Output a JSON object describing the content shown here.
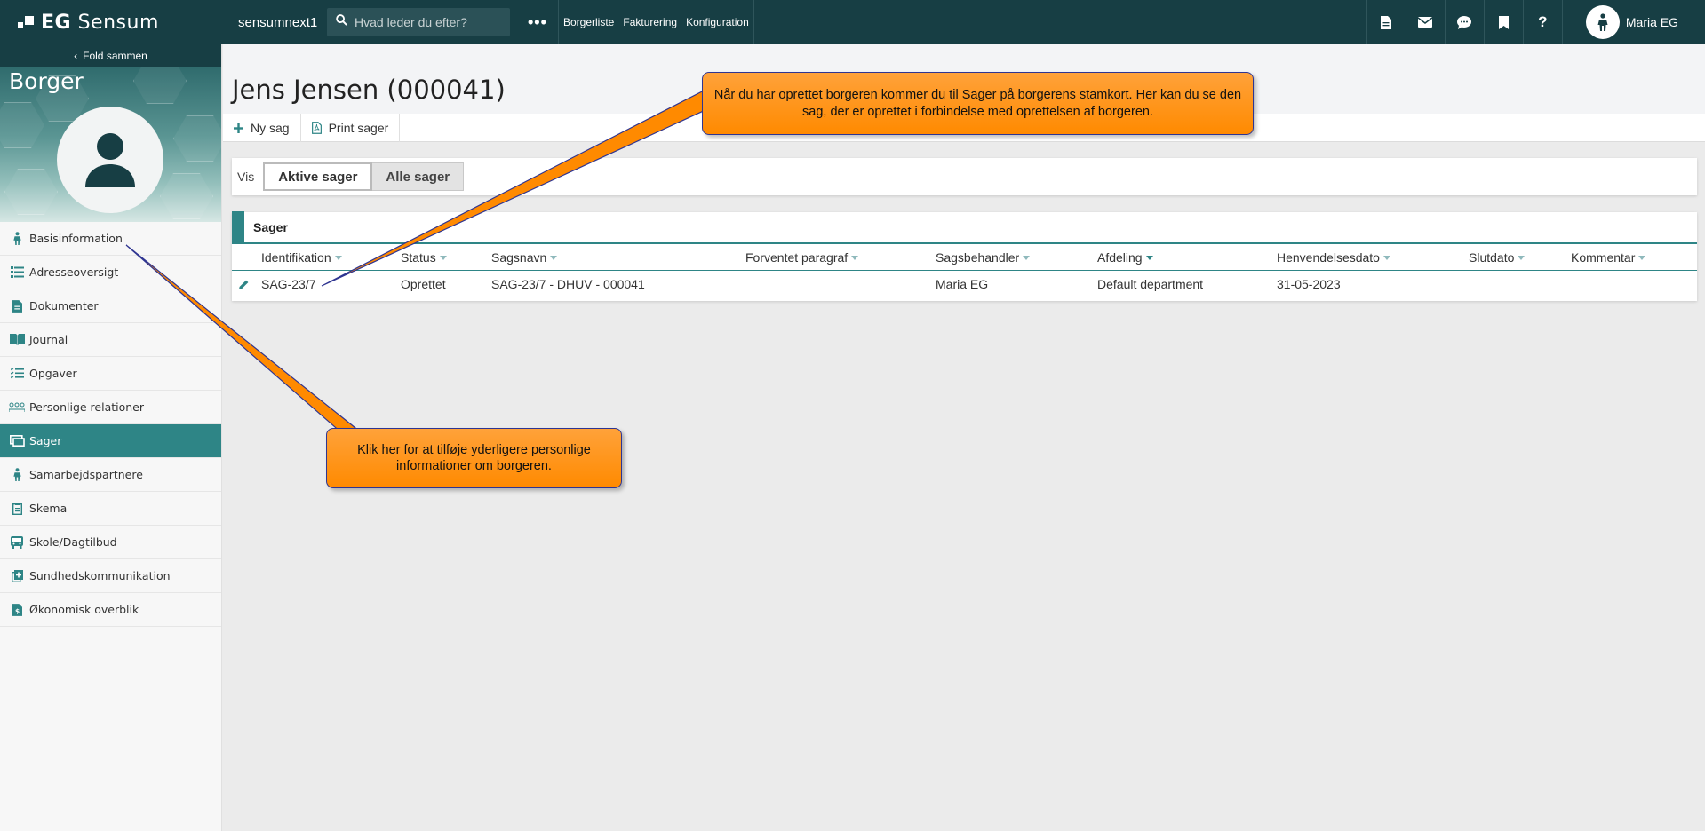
{
  "topbar": {
    "brand_prefix": "EG",
    "brand_name": "Sensum",
    "environment": "sensumnext1",
    "search_placeholder": "Hvad leder du efter?",
    "more": "•••",
    "nav": [
      "Borgerliste",
      "Fakturering",
      "Konfiguration"
    ],
    "user_name": "Maria EG"
  },
  "sidebar": {
    "fold_label": "Fold sammen",
    "title": "Borger",
    "items": [
      {
        "label": "Basisinformation",
        "icon": "person-icon"
      },
      {
        "label": "Adresseoversigt",
        "icon": "address-list-icon"
      },
      {
        "label": "Dokumenter",
        "icon": "document-icon"
      },
      {
        "label": "Journal",
        "icon": "book-icon"
      },
      {
        "label": "Opgaver",
        "icon": "checklist-icon"
      },
      {
        "label": "Personlige relationer",
        "icon": "relations-icon"
      },
      {
        "label": "Sager",
        "icon": "case-icon",
        "active": true
      },
      {
        "label": "Samarbejdspartnere",
        "icon": "person-icon"
      },
      {
        "label": "Skema",
        "icon": "clipboard-icon"
      },
      {
        "label": "Skole/Dagtilbud",
        "icon": "bus-icon"
      },
      {
        "label": "Sundhedskommunikation",
        "icon": "health-icon"
      },
      {
        "label": "Økonomisk overblik",
        "icon": "money-doc-icon"
      }
    ]
  },
  "main": {
    "title": "Jens Jensen (000041)",
    "toolbar": {
      "new_case": "Ny sag",
      "print_cases": "Print sager"
    },
    "filter": {
      "label": "Vis",
      "options": [
        "Aktive sager",
        "Alle sager"
      ],
      "selected": "Aktive sager"
    },
    "cases": {
      "title": "Sager",
      "columns": [
        "Identifikation",
        "Status",
        "Sagsnavn",
        "Forventet paragraf",
        "Sagsbehandler",
        "Afdeling",
        "Henvendelsesdato",
        "Slutdato",
        "Kommentar"
      ],
      "rows": [
        {
          "id": "SAG-23/7",
          "status": "Oprettet",
          "name": "SAG-23/7 - DHUV - 000041",
          "paragraph": "",
          "caseworker": "Maria EG",
          "department": "Default department",
          "date": "31-05-2023",
          "end": "",
          "comment": ""
        }
      ]
    }
  },
  "callouts": {
    "top": "Når du har oprettet borgeren kommer du til Sager på borgerens stamkort. Her kan du se den sag, der er oprettet i forbindelse med oprettelsen af borgeren.",
    "left": "Klik her for at tilføje yderligere personlige informationer om borgeren."
  },
  "colors": {
    "topbar": "#173e44",
    "accent": "#2e8586",
    "callout": "#ff8a00",
    "callout_border": "#2f3591"
  }
}
